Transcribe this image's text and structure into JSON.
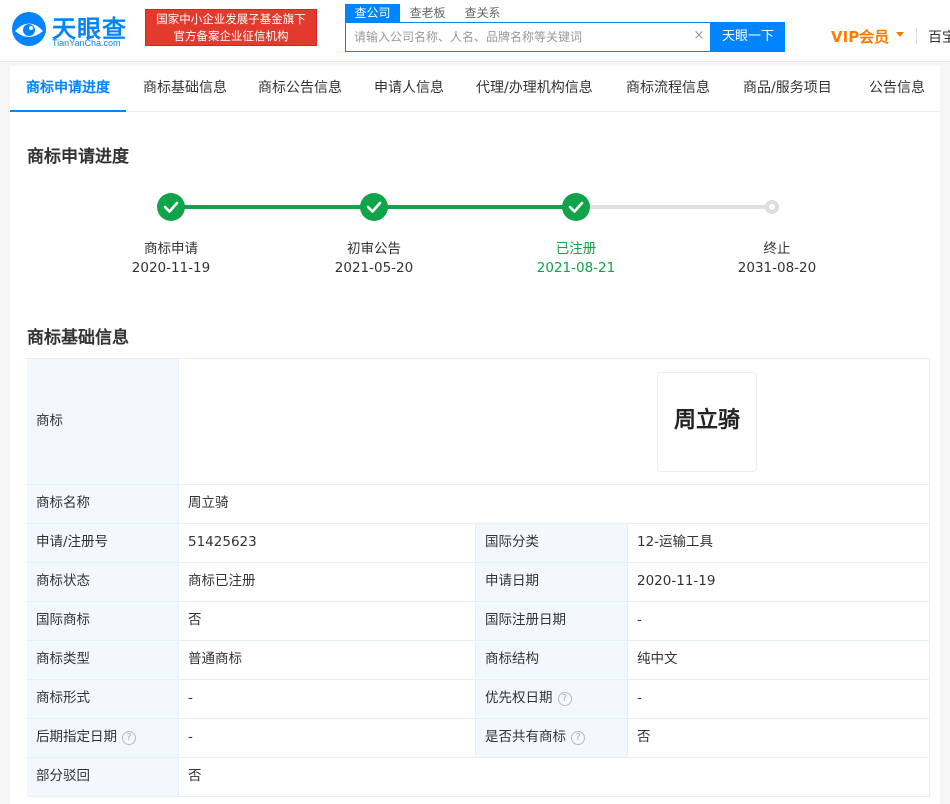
{
  "header": {
    "logo_text": "天眼查",
    "logo_sub": "TianYanCha.com",
    "badge_line1": "国家中小企业发展子基金旗下",
    "badge_line2": "官方备案企业征信机构",
    "search_tabs": [
      "查公司",
      "查老板",
      "查关系"
    ],
    "search_placeholder": "请输入公司名称、人名、品牌名称等关键词",
    "clear_glyph": "×",
    "search_button": "天眼一下",
    "vip_label": "VIP会员",
    "right_text": "百宝"
  },
  "nav": {
    "items": [
      "商标申请进度",
      "商标基础信息",
      "商标公告信息",
      "申请人信息",
      "代理/办理机构信息",
      "商标流程信息",
      "商品/服务项目",
      "公告信息"
    ],
    "active": "商标申请进度"
  },
  "progress": {
    "title": "商标申请进度",
    "steps": [
      {
        "label": "商标申请",
        "date": "2020-11-19",
        "status": "done"
      },
      {
        "label": "初审公告",
        "date": "2021-05-20",
        "status": "done"
      },
      {
        "label": "已注册",
        "date": "2021-08-21",
        "status": "current"
      },
      {
        "label": "终止",
        "date": "2031-08-20",
        "status": "pending"
      }
    ],
    "colors": {
      "done": "#0fa34a",
      "pending": "#dddddd"
    }
  },
  "basic": {
    "title": "商标基础信息",
    "trademark_key": "商标",
    "trademark_image_text": "周立骑",
    "name_key": "商标名称",
    "name_value": "周立骑",
    "rows": [
      {
        "k1": "申请/注册号",
        "v1": "51425623",
        "k2": "国际分类",
        "v2": "12-运输工具"
      },
      {
        "k1": "商标状态",
        "v1": "商标已注册",
        "k2": "申请日期",
        "v2": "2020-11-19"
      },
      {
        "k1": "国际商标",
        "v1": "否",
        "k2": "国际注册日期",
        "v2": "-"
      },
      {
        "k1": "商标类型",
        "v1": "普通商标",
        "k2": "商标结构",
        "v2": "纯中文"
      },
      {
        "k1": "商标形式",
        "v1": "-",
        "k2": "优先权日期",
        "v2": "-"
      },
      {
        "k1": "后期指定日期",
        "v1": "-",
        "k2": "是否共有商标",
        "v2": "否"
      }
    ],
    "last_key": "部分驳回",
    "last_value": "否"
  }
}
